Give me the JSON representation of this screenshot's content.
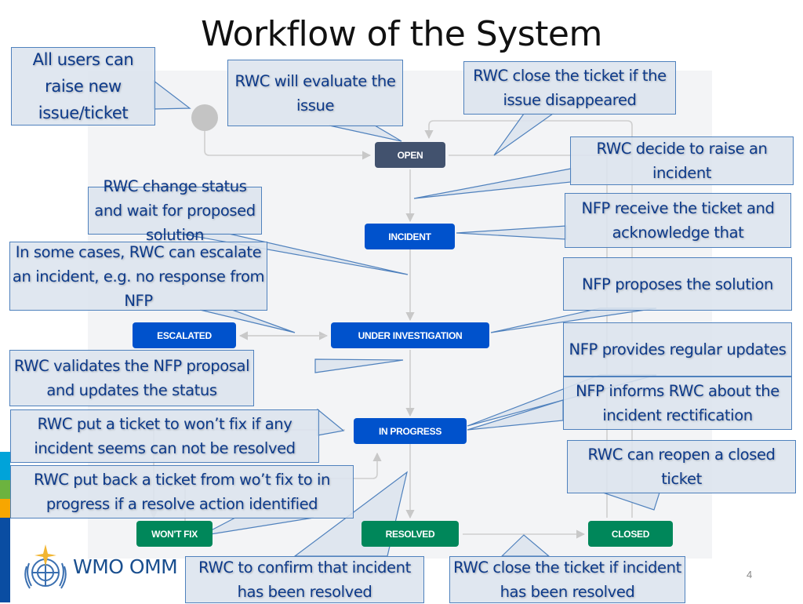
{
  "slide": {
    "title": "Workflow of the System",
    "page_number": "4",
    "logo_text": "WMO OMM"
  },
  "colors": {
    "status_open": "#42526e",
    "status_blue": "#0052cc",
    "status_green": "#00875a",
    "callout_border": "#4f81bd",
    "callout_text": "#0d3a8a",
    "stripe_cyan": "#00a3d9",
    "stripe_green": "#6cb33f",
    "stripe_orange": "#f7a600",
    "stripe_navy": "#0a4da2"
  },
  "statuses": {
    "open": "OPEN",
    "incident": "INCIDENT",
    "escalated": "ESCALATED",
    "under_investigation": "UNDER INVESTIGATION",
    "in_progress": "IN PROGRESS",
    "wont_fix": "WON'T FIX",
    "resolved": "RESOLVED",
    "closed": "CLOSED"
  },
  "callouts": {
    "raise_issue": "All users can raise new issue/ticket",
    "evaluate": "RWC will evaluate the issue",
    "close_disappeared": "RWC close the ticket if the issue disappeared",
    "raise_incident": "RWC decide to raise an incident",
    "change_status": "RWC change status and wait for proposed solution",
    "nfp_receive": "NFP receive the ticket and acknowledge that",
    "escalate": "In some cases, RWC can escalate an incident, e.g. no response from NFP",
    "nfp_proposes": "NFP proposes the solution",
    "validates": "RWC validates the NFP proposal and updates the status",
    "nfp_updates": "NFP provides regular updates",
    "nfp_informs": "NFP informs RWC about the incident rectification",
    "wont_fix": "RWC put a ticket to won’t fix if any incident seems can not be resolved",
    "reopen": "RWC can reopen a closed ticket",
    "put_back": "RWC put back a ticket from wo’t fix to in progress if a resolve action identified",
    "confirm_resolved": "RWC to confirm that incident has been resolved",
    "close_resolved": "RWC close the ticket if incident has been resolved"
  }
}
